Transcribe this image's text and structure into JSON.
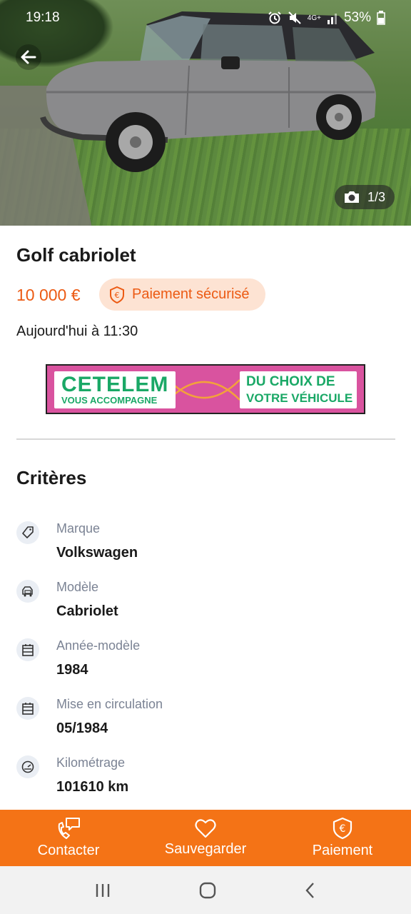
{
  "status_bar": {
    "time": "19:18",
    "network": "4G+",
    "battery": "53%"
  },
  "photo": {
    "counter": "1/3"
  },
  "listing": {
    "title": "Golf cabriolet",
    "price": "10 000 €",
    "secure_payment": "Paiement sécurisé",
    "date": "Aujourd'hui à 11:30"
  },
  "ad": {
    "brand": "CETELEM",
    "tagline_left": "VOUS ACCOMPAGNE",
    "tagline_right_1": "DU CHOIX DE",
    "tagline_right_2": "VOTRE VÉHICULE"
  },
  "criteria": {
    "title": "Critères",
    "items": [
      {
        "label": "Marque",
        "value": "Volkswagen",
        "icon": "tag-icon"
      },
      {
        "label": "Modèle",
        "value": "Cabriolet",
        "icon": "car-model-icon"
      },
      {
        "label": "Année-modèle",
        "value": "1984",
        "icon": "calendar-icon"
      },
      {
        "label": "Mise en circulation",
        "value": "05/1984",
        "icon": "calendar-icon"
      },
      {
        "label": "Kilométrage",
        "value": "101610 km",
        "icon": "speedometer-icon"
      }
    ]
  },
  "actions": {
    "contact": "Contacter",
    "save": "Sauvegarder",
    "payment": "Paiement"
  },
  "colors": {
    "accent": "#f47316",
    "price": "#ec5a13",
    "badge_bg": "#fde3d3"
  }
}
